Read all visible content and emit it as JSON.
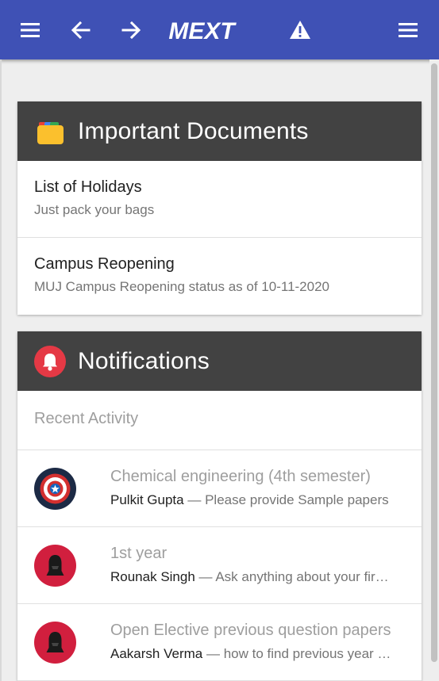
{
  "app_bar": {
    "logo_text": "MEXT",
    "color": "#3f51b5",
    "icons": [
      "menu-icon",
      "back-arrow-icon",
      "forward-arrow-icon",
      "warning-icon",
      "menu-icon"
    ]
  },
  "documents": {
    "title": "Important Documents",
    "icon": "folder-icon",
    "items": [
      {
        "title": "List of Holidays",
        "subtitle": "Just pack your bags"
      },
      {
        "title": "Campus Reopening",
        "subtitle": "MUJ Campus Reopening status as of 10-11-2020"
      }
    ]
  },
  "notifications": {
    "title": "Notifications",
    "icon": "bell-icon",
    "section_label": "Recent Activity",
    "separator": "—",
    "items": [
      {
        "title": "Chemical engineering (4th semester)",
        "author": "Pulkit Gupta",
        "text": "Please provide Sample papers",
        "avatar": "shield-avatar"
      },
      {
        "title": "1st year",
        "author": "Rounak Singh",
        "text": "Ask anything about your first year",
        "avatar": "helmet-avatar"
      },
      {
        "title": "Open Elective previous question papers",
        "author": "Aakarsh Verma",
        "text": "how to find previous year papers",
        "avatar": "helmet-avatar"
      }
    ]
  }
}
